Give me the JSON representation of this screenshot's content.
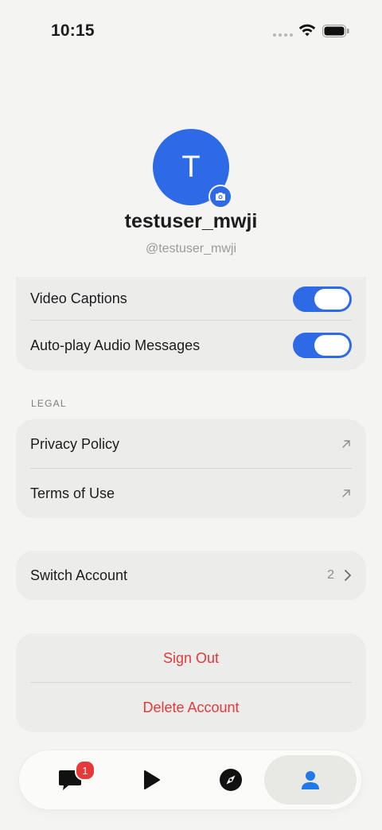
{
  "status_bar": {
    "time": "10:15"
  },
  "profile": {
    "avatar_initial": "T",
    "username": "testuser_mwji",
    "handle": "@testuser_mwji"
  },
  "media_settings": {
    "items": [
      {
        "label": "Video Captions",
        "enabled": true
      },
      {
        "label": "Auto-play Audio Messages",
        "enabled": true
      }
    ]
  },
  "legal": {
    "header": "LEGAL",
    "items": [
      {
        "label": "Privacy Policy",
        "icon": "external-link-icon"
      },
      {
        "label": "Terms of Use",
        "icon": "external-link-icon"
      }
    ]
  },
  "account": {
    "switch_label": "Switch Account",
    "switch_count": "2"
  },
  "danger": {
    "sign_out": "Sign Out",
    "delete_account": "Delete Account",
    "color": "#e5393a"
  },
  "tab_bar": {
    "tabs": [
      {
        "name": "chats",
        "icon": "chat-bubble-icon",
        "badge": "1"
      },
      {
        "name": "play",
        "icon": "play-icon"
      },
      {
        "name": "discover",
        "icon": "compass-icon"
      },
      {
        "name": "profile",
        "icon": "person-icon",
        "active": true
      }
    ]
  },
  "colors": {
    "accent": "#2f6ae6",
    "background": "#f4f4f2"
  }
}
